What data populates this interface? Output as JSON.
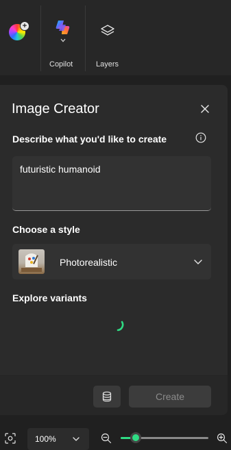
{
  "toolbar": {
    "color_picker": {
      "icon": "color-wheel-icon"
    },
    "copilot": {
      "label": "Copilot",
      "icon": "copilot-icon",
      "chevron": "chevron-down-icon"
    },
    "layers": {
      "label": "Layers",
      "icon": "layers-icon"
    }
  },
  "image_creator": {
    "title": "Image Creator",
    "describe_label": "Describe what you'd like to create",
    "prompt_value": "futuristic humanoid",
    "style_label": "Choose a style",
    "style_value": "Photorealistic",
    "variants_label": "Explore variants",
    "create_label": "Create",
    "accent_color": "#2fdc84"
  },
  "statusbar": {
    "zoom_value": "100%",
    "zoom_level": 0.17
  }
}
